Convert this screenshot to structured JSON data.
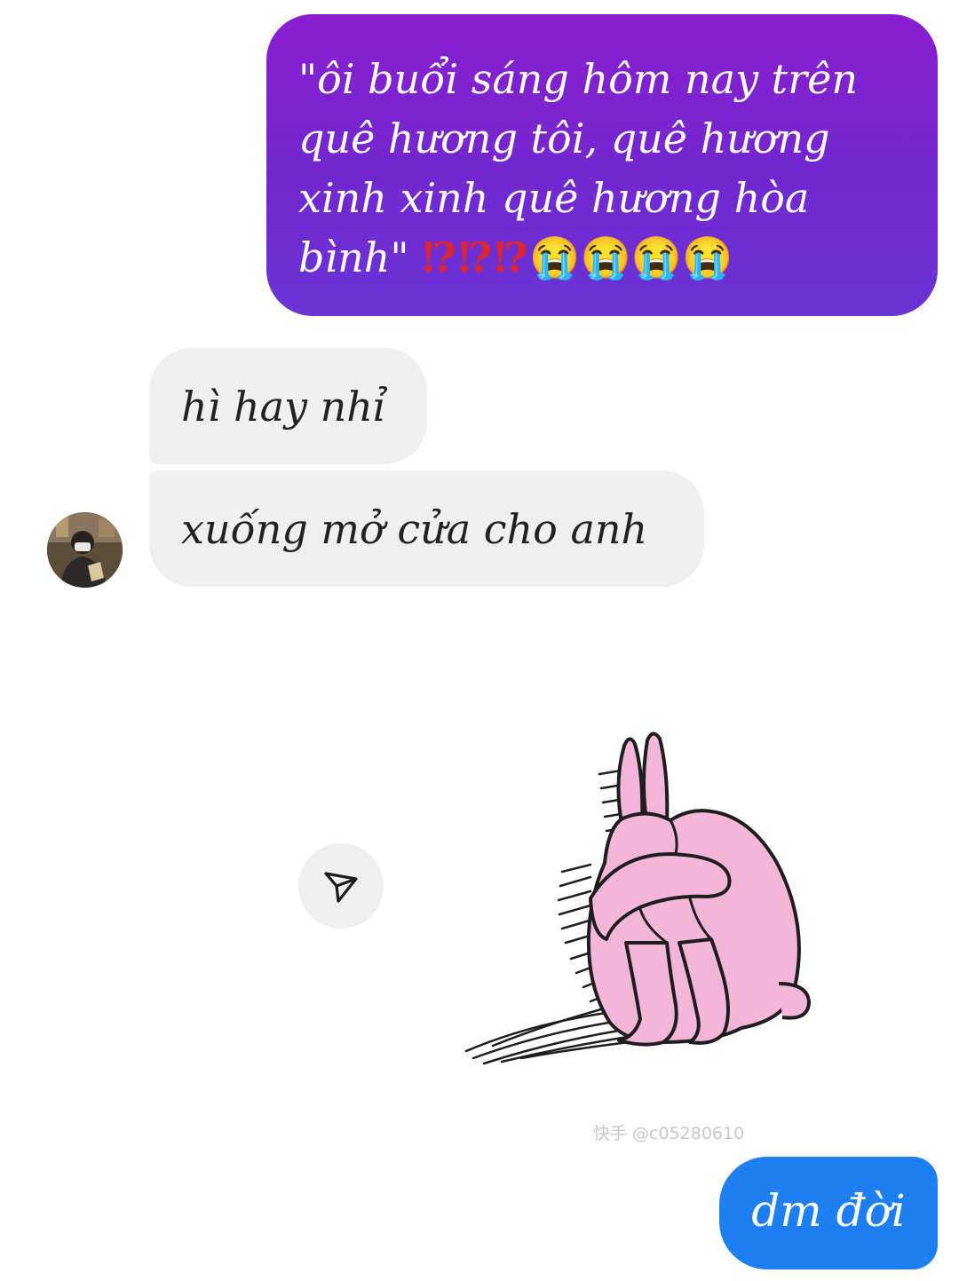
{
  "messages": {
    "outgoing_1": {
      "text": "\"ôi buổi sáng hôm nay trên quê hương tôi, quê hương xinh xinh quê hương hòa bình\"",
      "marks": "⁉⁉⁉",
      "emojis": "😭😭😭😭"
    },
    "incoming_1": {
      "text": "hì hay nhỉ"
    },
    "incoming_2": {
      "text": "xuống mở cửa cho anh"
    },
    "outgoing_2": {
      "text": "dm đời"
    }
  },
  "sticker": {
    "icon": "crying-pink-rabbit-sticker",
    "watermark": "快手 @c05280610"
  },
  "share": {
    "icon": "send-icon"
  },
  "colors": {
    "outgoing_gradient_top": "#8a1ed0",
    "outgoing_gradient_bottom": "#6a34d6",
    "incoming_bubble": "#efefef",
    "outgoing_blue": "#1e7ff2",
    "rabbit_pink": "#f4b6d8"
  }
}
